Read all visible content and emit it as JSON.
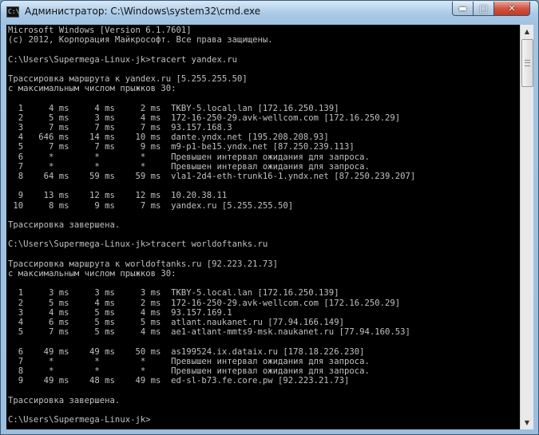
{
  "window": {
    "title": "Администратор: C:\\Windows\\system32\\cmd.exe",
    "icon": "cmd-icon",
    "icon_glyph": "C:\\",
    "minimize_glyph": "▬",
    "maximize_glyph": "□",
    "close_glyph": "✕"
  },
  "scrollbar": {
    "up_glyph": "▲",
    "down_glyph": "▼"
  },
  "console": {
    "lines": [
      "Microsoft Windows [Version 6.1.7601]",
      "(c) 2012, Корпорация Майкрософт. Все права защищены.",
      "",
      "C:\\Users\\Supermega-Linux-jk>tracert yandex.ru",
      "",
      "Трассировка маршрута к yandex.ru [5.255.255.50]",
      "с максимальным числом прыжков 30:",
      "",
      "  1     4 ms     4 ms     2 ms  TKBY-5.local.lan [172.16.250.139]",
      "  2     5 ms     3 ms     4 ms  172-16-250-29.avk-wellcom.com [172.16.250.29]",
      "  3     7 ms     7 ms     7 ms  93.157.168.3",
      "  4   646 ms    14 ms    10 ms  dante.yndx.net [195.208.208.93]",
      "  5     7 ms     7 ms     9 ms  m9-p1-be15.yndx.net [87.250.239.113]",
      "  6     *        *        *     Превышен интервал ожидания для запроса.",
      "  7     *        *        *     Превышен интервал ожидания для запроса.",
      "  8    64 ms    59 ms    59 ms  vla1-2d4-eth-trunk16-1.yndx.net [87.250.239.207]",
      "",
      "  9    13 ms    12 ms    12 ms  10.20.38.11",
      " 10     8 ms     9 ms     7 ms  yandex.ru [5.255.255.50]",
      "",
      "Трассировка завершена.",
      "",
      "C:\\Users\\Supermega-Linux-jk>tracert worldoftanks.ru",
      "",
      "Трассировка маршрута к worldoftanks.ru [92.223.21.73]",
      "с максимальным числом прыжков 30:",
      "",
      "  1     3 ms     3 ms     3 ms  TKBY-5.local.lan [172.16.250.139]",
      "  2     5 ms     4 ms     2 ms  172-16-250-29.avk-wellcom.com [172.16.250.29]",
      "  3     4 ms     5 ms     4 ms  93.157.169.1",
      "  4     6 ms     5 ms     5 ms  atlant.naukanet.ru [77.94.166.149]",
      "  5     7 ms     5 ms     4 ms  ae1-atlant-mmts9-msk.naukanet.ru [77.94.160.53]",
      "",
      "  6    49 ms    49 ms    50 ms  as199524.ix.dataix.ru [178.18.226.230]",
      "  7     *        *        *     Превышен интервал ожидания для запроса.",
      "  8     *        *        *     Превышен интервал ожидания для запроса.",
      "  9    49 ms    48 ms    49 ms  ed-sl-b73.fe.core.pw [92.223.21.73]",
      "",
      "Трассировка завершена.",
      "",
      "C:\\Users\\Supermega-Linux-jk>"
    ]
  }
}
